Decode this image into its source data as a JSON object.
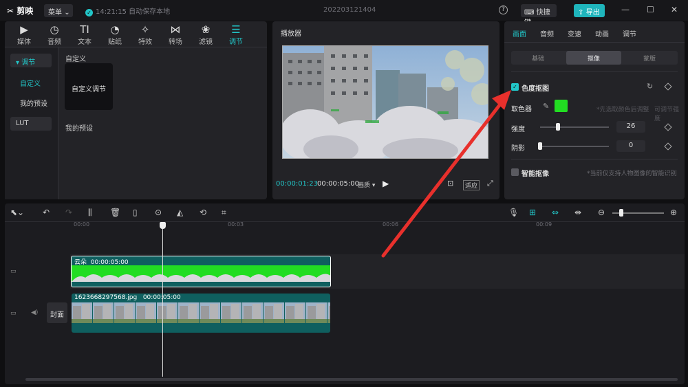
{
  "titlebar": {
    "app_name": "剪映",
    "menu_label": "菜单",
    "save_time": "14:21:15",
    "save_text": "自动保存本地",
    "project_name": "202203121404",
    "shortcut_label": "快捷键",
    "export_label": "导出"
  },
  "library": {
    "tabs": [
      {
        "icon": "media-icon",
        "label": "媒体"
      },
      {
        "icon": "audio-icon",
        "label": "音频"
      },
      {
        "icon": "text-icon",
        "label": "文本"
      },
      {
        "icon": "sticker-icon",
        "label": "贴纸"
      },
      {
        "icon": "effects-icon",
        "label": "特效"
      },
      {
        "icon": "transition-icon",
        "label": "转场"
      },
      {
        "icon": "filter-icon",
        "label": "滤镜"
      },
      {
        "icon": "adjust-icon",
        "label": "调节"
      }
    ],
    "side": {
      "adjust": "调节",
      "custom": "自定义",
      "my_presets": "我的预设",
      "lut": "LUT"
    },
    "section_custom": "自定义",
    "card_label": "自定义调节",
    "section_presets": "我的预设"
  },
  "player": {
    "title": "播放器",
    "current_time": "00:00:01:23",
    "total_time": "00:00:05:00",
    "ratio_label": "画质",
    "fit_label": "适应"
  },
  "props": {
    "tabs": [
      "画面",
      "音频",
      "变速",
      "动画",
      "调节"
    ],
    "sub_tabs": [
      "基础",
      "抠像",
      "蒙版"
    ],
    "chroma_key": "色度抠图",
    "picker_label": "取色器",
    "picker_hint": "*先选取颜色后调整",
    "picker_hint2": "可调节强度",
    "picker_color": "#22dd22",
    "intensity_label": "强度",
    "intensity_value": "26",
    "intensity_level": 0.26,
    "shadow_label": "阴影",
    "shadow_value": "0",
    "shadow_level": 0,
    "smart_cutout": "智能抠像",
    "smart_hint": "*当前仅支持人物图像的智能识别"
  },
  "timeline": {
    "ticks": [
      "00:00",
      "00:03",
      "00:06",
      "00:09"
    ],
    "clip1_name": "云朵",
    "clip1_duration": "00:00:05:00",
    "clip2_name": "1623668297568.jpg",
    "clip2_duration": "00:00:05:00",
    "cover_label": "封面"
  },
  "colors": {
    "accent": "#22c6c8",
    "annotation_arrow": "#e8302c"
  }
}
